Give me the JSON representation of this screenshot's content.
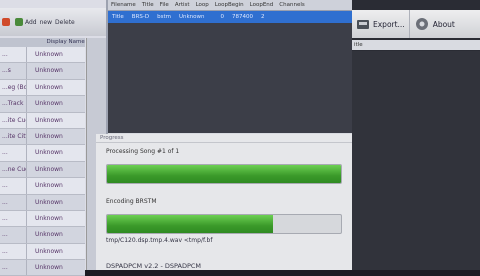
{
  "left": {
    "toolbar": {
      "item1": "",
      "item2": "Add",
      "item3": "new",
      "item4": "Delete"
    },
    "header": {
      "col1": "",
      "col2": "Display Name"
    },
    "rows": [
      {
        "name": "...",
        "value": "Unknown"
      },
      {
        "name": "...s",
        "value": "Unknown"
      },
      {
        "name": "...eg (Bo)",
        "value": "Unknown"
      },
      {
        "name": "...Track",
        "value": "Unknown"
      },
      {
        "name": "...ite Cuo",
        "value": "Unknown"
      },
      {
        "name": "...ite City",
        "value": "Unknown"
      },
      {
        "name": "...",
        "value": "Unknown"
      },
      {
        "name": "...ne Cuo",
        "value": "Unknown"
      },
      {
        "name": "...",
        "value": "Unknown"
      },
      {
        "name": "...",
        "value": "Unknown"
      },
      {
        "name": "...",
        "value": "Unknown"
      },
      {
        "name": "...",
        "value": "Unknown"
      },
      {
        "name": "...",
        "value": "Unknown"
      },
      {
        "name": "...",
        "value": "Unknown"
      }
    ]
  },
  "center": {
    "columns": [
      "Filename",
      "Title",
      "File",
      "Artist",
      "Loop",
      "LoopBegin",
      "LoopEnd",
      "Channels"
    ],
    "selected_row": [
      "Title",
      "BRS-D",
      "bstm",
      "Unknown",
      "",
      "0",
      "787400",
      "2"
    ],
    "progress": {
      "title": "Progress",
      "song_label": "Processing Song #1 of 1",
      "song_fraction": 1.0,
      "encode_label": "Encoding BRSTM",
      "encode_fraction": 0.71,
      "path_text": "tmp/C120.dsp.tmp.4.wav <tmp/f.bf",
      "dsp_text": "DSPADPCM v2.2 - DSPADPCM"
    }
  },
  "right": {
    "export_label": "Export...",
    "about_label": "About",
    "header_label": "itle"
  },
  "colors": {
    "selection": "#2f6fd0",
    "progress_green": "#3b9a2a",
    "dark_bg": "#1b1c22"
  }
}
